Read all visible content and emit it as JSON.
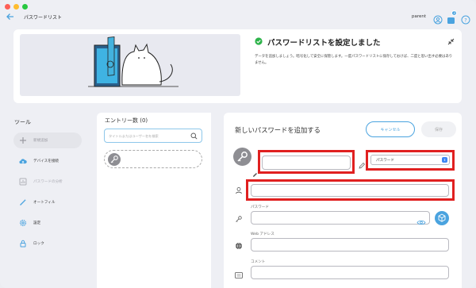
{
  "app": {
    "title": "パスワードリスト",
    "user": "parent",
    "notification_count": "3"
  },
  "banner": {
    "title": "パスワードリストを設定しました",
    "description": "データを追加しましょう。暗号化して安全に保管します。一度パスワードリストに保存しておけば、二度と思い出す必要はありません。"
  },
  "sidebar": {
    "heading": "ツール",
    "items": [
      {
        "label": "新規追加",
        "icon": "plus-icon"
      },
      {
        "label": "デバイスを接続",
        "icon": "cloud-upload-icon"
      },
      {
        "label": "パスワードの分析",
        "icon": "analysis-icon"
      },
      {
        "label": "オートフィル",
        "icon": "autofill-icon"
      },
      {
        "label": "設定",
        "icon": "gear-icon"
      },
      {
        "label": "ロック",
        "icon": "lock-icon"
      }
    ]
  },
  "list": {
    "heading": "エントリー数 (0)",
    "search_placeholder": "タイトルまたはユーザー名を検索"
  },
  "form": {
    "title": "新しいパスワードを追加する",
    "cancel_label": "キャンセル",
    "save_label": "保存",
    "type_value": "パスワード",
    "password_label": "パスワード",
    "web_label": "Web アドレス",
    "comment_label": "コメント"
  },
  "colors": {
    "accent": "#4aa3df",
    "highlight": "#e02020",
    "success": "#2db34a"
  }
}
